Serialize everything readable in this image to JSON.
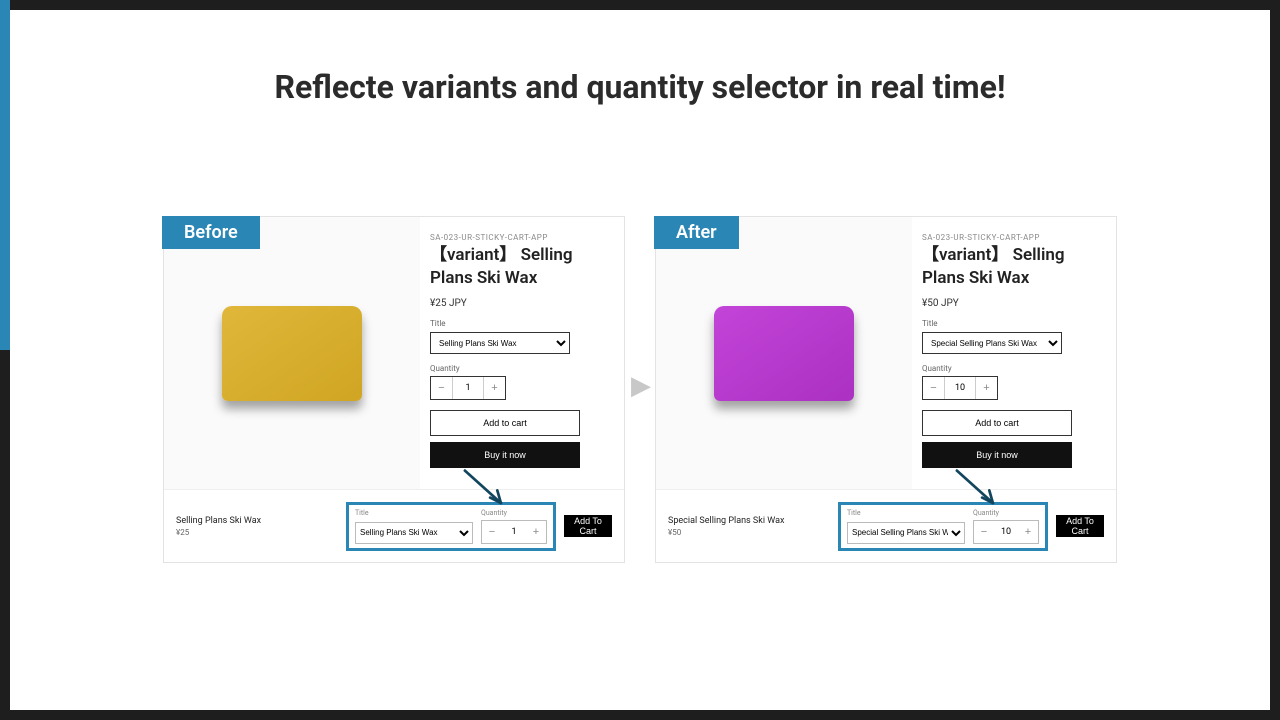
{
  "title": "Reflecte variants and quantity selector in real time!",
  "before": {
    "tag": "Before",
    "sku": "SA-023-UR-STICKY-CART-APP",
    "product_title": "【variant】 Selling Plans Ski Wax",
    "price": "¥25 JPY",
    "title_label": "Title",
    "title_option": "Selling Plans Ski Wax",
    "qty_label": "Quantity",
    "qty": "1",
    "add_to_cart": "Add to cart",
    "buy_now": "Buy it now",
    "sticky_name": "Selling Plans Ski Wax",
    "sticky_price": "¥25",
    "sticky_title_label": "Title",
    "sticky_title_option": "Selling Plans Ski Wax",
    "sticky_qty_label": "Quantity",
    "sticky_qty": "1",
    "sticky_add": "Add To Cart"
  },
  "after": {
    "tag": "After",
    "sku": "SA-023-UR-STICKY-CART-APP",
    "product_title": "【variant】 Selling Plans Ski Wax",
    "price": "¥50 JPY",
    "title_label": "Title",
    "title_option": "Special Selling Plans Ski Wax",
    "qty_label": "Quantity",
    "qty": "10",
    "add_to_cart": "Add to cart",
    "buy_now": "Buy it now",
    "sticky_name": "Special Selling Plans Ski Wax",
    "sticky_price": "¥50",
    "sticky_title_label": "Title",
    "sticky_title_option": "Special Selling Plans Ski Wax",
    "sticky_qty_label": "Quantity",
    "sticky_qty": "10",
    "sticky_add": "Add To Cart"
  }
}
